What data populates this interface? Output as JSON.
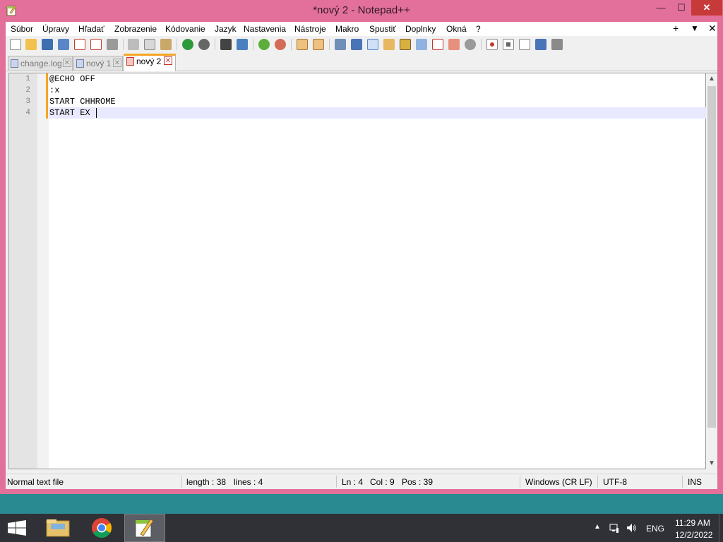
{
  "window": {
    "title": "*nový 2 - Notepad++",
    "min_glyph": "—",
    "max_glyph": "☐",
    "close_glyph": "✕"
  },
  "menubar": {
    "items": [
      "Súbor",
      "Úpravy",
      "Hľadať",
      "Zobrazenie",
      "Kódovanie",
      "Jazyk",
      "Nastavenia",
      "Nástroje",
      "Makro",
      "Spustiť",
      "Doplnky",
      "Okná",
      "?"
    ],
    "right": [
      "+",
      "▼",
      "✕"
    ]
  },
  "toolbar": {
    "icons": [
      "new-file-icon",
      "open-file-icon",
      "save-icon",
      "save-all-icon",
      "close-icon",
      "close-all-icon",
      "print-icon",
      "cut-icon",
      "copy-icon",
      "paste-icon",
      "undo-icon",
      "redo-icon",
      "find-icon",
      "replace-icon",
      "zoom-in-icon",
      "zoom-out-icon",
      "sync-vertical-icon",
      "sync-horizontal-icon",
      "word-wrap-icon",
      "show-all-chars-icon",
      "indent-guide-icon",
      "user-lang-icon",
      "doc-map-icon",
      "function-list-icon",
      "folder-workspace-icon",
      "monitoring-icon",
      "record-macro-icon",
      "stop-macro-icon",
      "play-macro-icon",
      "run-macro-multiple-icon",
      "save-macro-icon"
    ]
  },
  "tabs": [
    {
      "label": "change.log",
      "active": false
    },
    {
      "label": "nový 1",
      "active": false
    },
    {
      "label": "nový 2",
      "active": true
    }
  ],
  "editor": {
    "lines": [
      {
        "num": "1",
        "text": "@ECHO OFF"
      },
      {
        "num": "2",
        "text": ":x"
      },
      {
        "num": "3",
        "text": "START CHHROME"
      },
      {
        "num": "4",
        "text": "START EX"
      }
    ],
    "current_line": 4
  },
  "status": {
    "file_type": "Normal text file",
    "length": "length : 38",
    "lines": "lines : 4",
    "ln": "Ln : 4",
    "col": "Col : 9",
    "pos": "Pos : 39",
    "eol": "Windows (CR LF)",
    "encoding": "UTF-8",
    "mode": "INS"
  },
  "taskbar": {
    "apps": [
      "windows-start-icon",
      "file-explorer-icon",
      "chrome-icon",
      "notepadpp-icon"
    ],
    "tray": {
      "lang": "ENG",
      "time": "11:29 AM",
      "date": "12/2/2022"
    }
  },
  "colors": {
    "window_frame": "#e3709a",
    "taskbar": "#2f3136",
    "tab_accent": "#f5a623",
    "close_red": "#c73a3a",
    "current_line": "#e8e8ff"
  }
}
